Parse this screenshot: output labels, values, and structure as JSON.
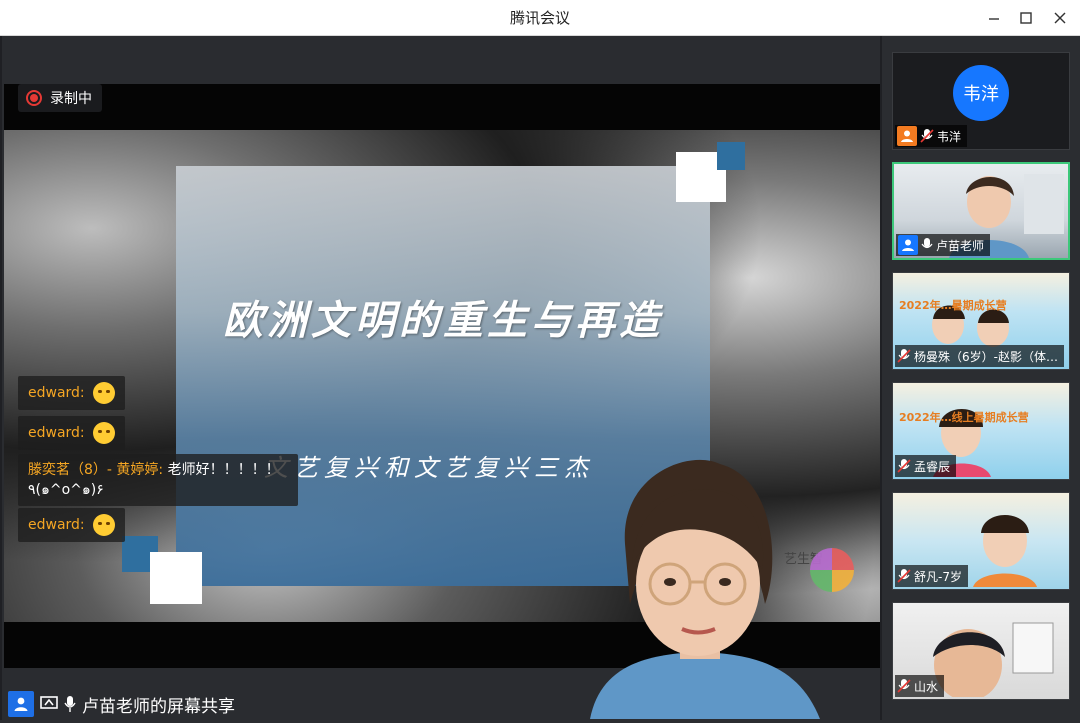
{
  "window": {
    "title": "腾讯会议"
  },
  "recording": {
    "label": "录制中"
  },
  "slide": {
    "title": "欧洲文明的重生与再造",
    "subtitle": "文艺复兴和文艺复兴三杰",
    "logo_text": "艺生智"
  },
  "chat": [
    {
      "name": "edward:",
      "text": "",
      "emoji": "laughing-tears"
    },
    {
      "name": "edward:",
      "text": "",
      "emoji": "hand-over-mouth"
    },
    {
      "name": "滕奕茗（8）- 黄婷婷:",
      "text": " 老师好！！！！！",
      "line2": "٩(๑^o^๑)۶"
    },
    {
      "name": "edward:",
      "text": "",
      "emoji": "crying"
    }
  ],
  "share_bar": {
    "label": "卢苗老师的屏幕共享"
  },
  "participants": [
    {
      "name": "韦洋",
      "avatar_text": "韦洋",
      "badge_color": "#f37b21"
    },
    {
      "name": "卢苗老师",
      "badge_color": "#1677ff"
    },
    {
      "name": "杨曼殊（6岁）-赵影（体…",
      "banner": "2022年…暑期成长营"
    },
    {
      "name": "孟睿辰",
      "banner": "2022年…线上暑期成长营"
    },
    {
      "name": "舒凡-7岁"
    },
    {
      "name": "山水"
    }
  ]
}
